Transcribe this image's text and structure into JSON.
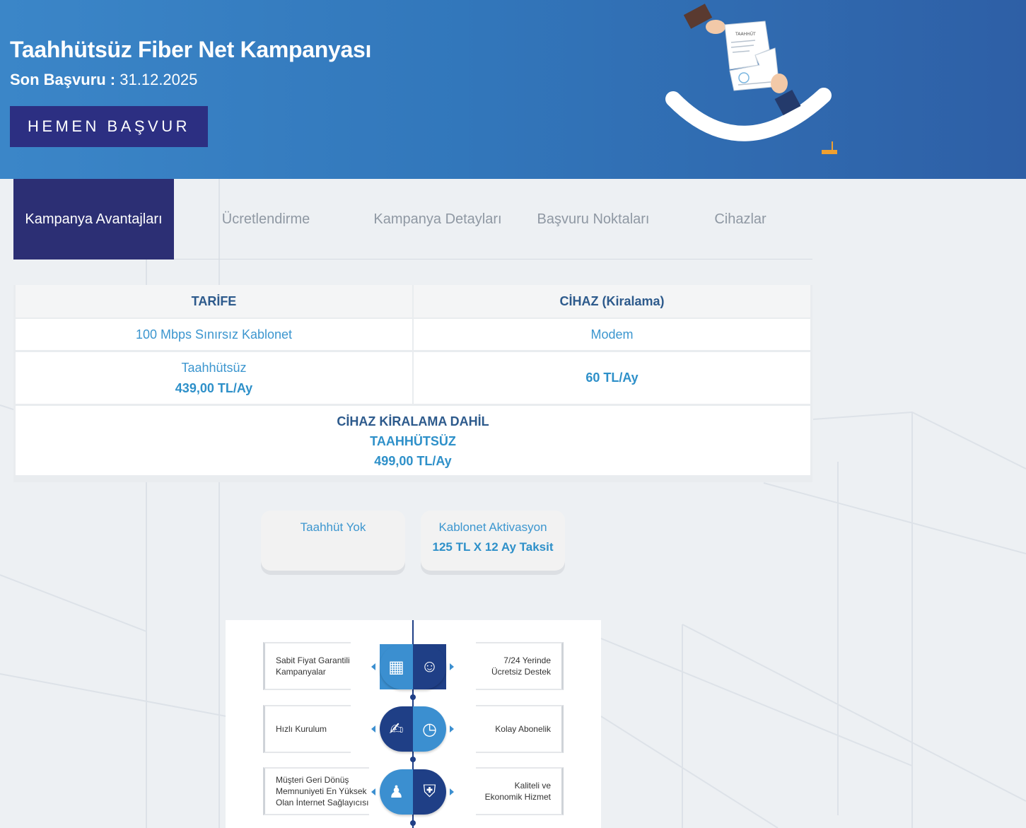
{
  "hero": {
    "title": "Taahhütsüz Fiber Net Kampanyası",
    "deadline_label": "Son Başvuru :",
    "deadline_value": "31.12.2025",
    "apply_button": "HEMEN BAŞVUR",
    "illustration_doc_text": "TAAHHÜT"
  },
  "tabs": [
    {
      "label": "Kampanya Avantajları",
      "active": true
    },
    {
      "label": "Ücretlendirme",
      "active": false
    },
    {
      "label": "Kampanya Detayları",
      "active": false
    },
    {
      "label": "Başvuru Noktaları",
      "active": false
    },
    {
      "label": "Cihazlar",
      "active": false
    }
  ],
  "price_table": {
    "col1_header": "TARİFE",
    "col2_header": "CİHAZ (Kiralama)",
    "tariff_name": "100 Mbps Sınırsız Kablonet",
    "device_name": "Modem",
    "tariff_commitment": "Taahhütsüz",
    "tariff_price": "439,00 TL/Ay",
    "device_price": "60 TL/Ay",
    "total_line1": "CİHAZ KİRALAMA DAHİL",
    "total_line2": "TAAHHÜTSÜZ",
    "total_price": "499,00 TL/Ay"
  },
  "cards": [
    {
      "line1": "Taahhüt Yok",
      "line2": ""
    },
    {
      "line1": "Kablonet Aktivasyon",
      "line2": "125 TL X 12 Ay Taksit"
    }
  ],
  "infographic": {
    "left": [
      [
        "Sabit Fiyat Garantili",
        "Kampanyalar"
      ],
      [
        "Hızlı Kurulum"
      ],
      [
        "Müşteri Geri Dönüş",
        "Memnuniyeti En Yüksek",
        "Olan İnternet Sağlayıcısı"
      ]
    ],
    "right": [
      [
        "7/24 Yerinde",
        "Ücretsiz Destek"
      ],
      [
        "Kolay Abonelik"
      ],
      [
        "Kaliteli ve",
        "Ekonomik Hizmet"
      ]
    ],
    "colors": {
      "dark": "#1f3f86",
      "light": "#3b8fd0"
    }
  },
  "colors": {
    "hero_start": "#3b86c8",
    "hero_end": "#2e5fa6",
    "active_tab": "#2c2f74",
    "button": "#2c2f82",
    "accent_text": "#2e90c9"
  }
}
